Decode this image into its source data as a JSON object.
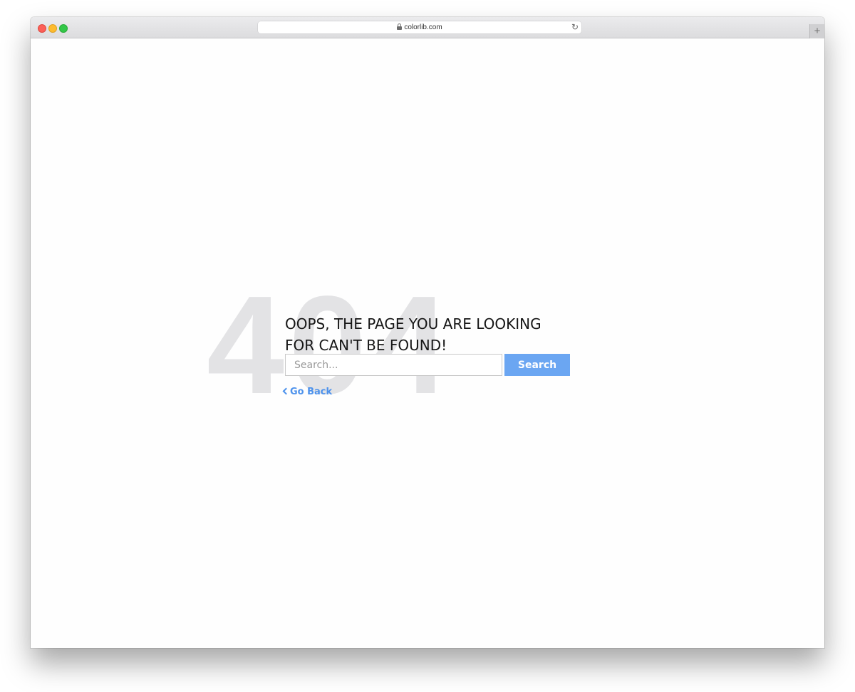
{
  "browser": {
    "url": "colorlib.com",
    "new_tab_label": "+"
  },
  "page": {
    "error_code": "404",
    "heading": "OOPS, THE PAGE YOU ARE LOOKING FOR CAN'T BE FOUND!",
    "search": {
      "placeholder": "Search...",
      "value": "",
      "button_label": "Search"
    },
    "go_back_label": "Go Back"
  },
  "colors": {
    "accent": "#6ba6f2",
    "link": "#4d92ec",
    "watermark": "#e3e3e5"
  }
}
